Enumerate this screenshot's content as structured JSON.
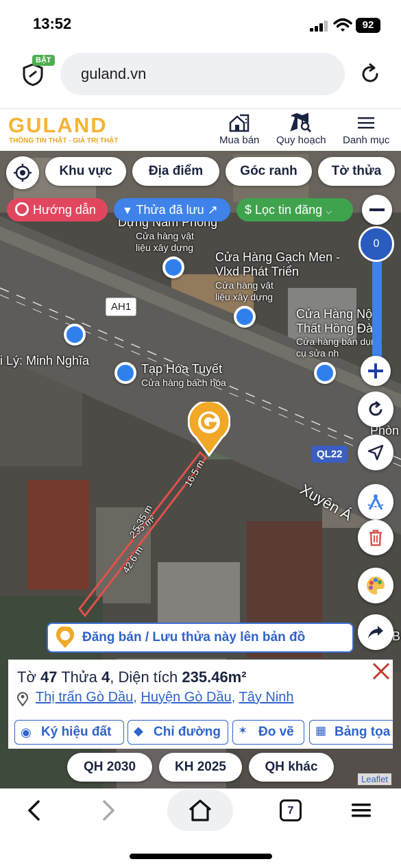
{
  "status_bar": {
    "time": "13:52",
    "battery": "92"
  },
  "browser": {
    "url": "guland.vn",
    "shield_badge": "BẬT"
  },
  "site": {
    "logo": "GULAND",
    "tagline": "THÔNG TIN THẬT - GIÁ TRỊ THẬT",
    "nav": [
      {
        "label": "Mua bán",
        "icon": "home-city-icon"
      },
      {
        "label": "Quy hoạch",
        "icon": "map-search-icon"
      },
      {
        "label": "Danh mục",
        "icon": "menu-icon"
      }
    ]
  },
  "map_filters": {
    "chips": [
      "Khu vực",
      "Địa điểm",
      "Góc ranh",
      "Tờ thửa"
    ],
    "guide": "Hướng dẫn",
    "saved": "Thửa đã lưu",
    "filter": "Lọc tin đăng"
  },
  "map_controls": {
    "zoom_value": "0"
  },
  "map_labels": {
    "store1_name": "Dựng Nam Phong",
    "store1_type": "Cửa hàng vật liệu xây dựng",
    "store2_name": "Cửa Hàng Gạch Men - Vlxd Phát Triển",
    "store2_type": "Cửa hàng vật liệu xây dựng",
    "store3_name": "Cửa Hàng Nội Thất Hồng Đào",
    "store3_type": "Cửa hàng bán dụng cụ sửa nh",
    "store4_name": "Tạp Hóa Tuyết",
    "store4_type": "Cửa hàng bách hóa",
    "left_label": "i Lý: Minh Nghĩa",
    "road_ah1": "AH1",
    "road_ql22": "QL22",
    "street": "Xuyên Á",
    "edge_phon": "Phòn",
    "edge_b": "B",
    "dim_top": "16.5 m",
    "dim_area": "235 m²",
    "dim_side": "5.35 m",
    "dim_long": "42.6 m"
  },
  "banner": {
    "text": "Đăng bán / Lưu thửa này lên bản đồ"
  },
  "parcel": {
    "sheet_label": "Tờ",
    "sheet": "47",
    "lot_label": "Thửa",
    "lot": "4",
    "area_label": ", Diện tích",
    "area": "235.46m²",
    "town": "Thị trấn Gò Dầu",
    "district": "Huyện Gò Dầu",
    "province": "Tây Ninh",
    "actions": [
      "Ký hiệu đất",
      "Chỉ đường",
      "Đo vẽ",
      "Bảng tọa"
    ]
  },
  "plans": [
    "QH 2030",
    "KH 2025",
    "QH khác"
  ],
  "attribution": "Leaflet",
  "browser_bottom": {
    "tabs_count": "7"
  }
}
